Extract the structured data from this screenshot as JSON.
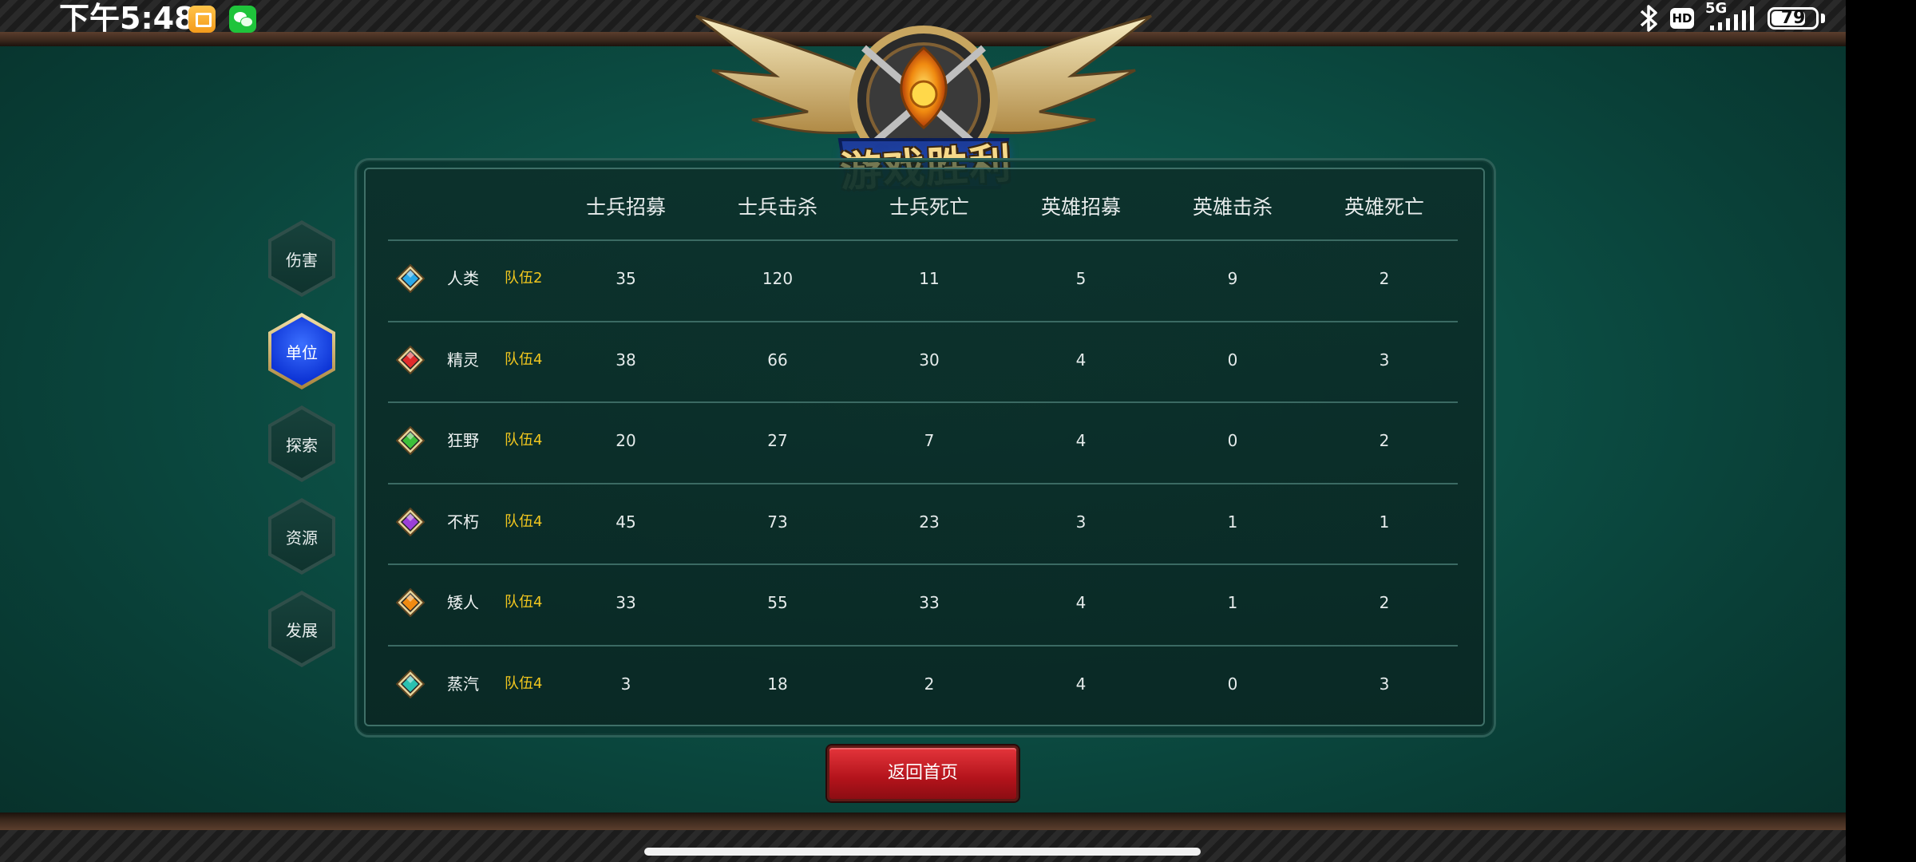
{
  "status_bar": {
    "time": "下午5:48",
    "hd": "HD",
    "network": "5G",
    "battery": "79",
    "battery_level": 0.79,
    "icons": [
      "notes-app-icon",
      "wechat-icon",
      "bluetooth-icon",
      "signal-icon",
      "battery-icon"
    ]
  },
  "emblem": {
    "title": "游戏胜利"
  },
  "nav": {
    "items": [
      {
        "label": "伤害",
        "active": false
      },
      {
        "label": "单位",
        "active": true
      },
      {
        "label": "探索",
        "active": false
      },
      {
        "label": "资源",
        "active": false
      },
      {
        "label": "发展",
        "active": false
      }
    ]
  },
  "table": {
    "headers": [
      "士兵招募",
      "士兵击杀",
      "士兵死亡",
      "英雄招募",
      "英雄击杀",
      "英雄死亡"
    ],
    "rows": [
      {
        "race": "人类",
        "team": "队伍2",
        "gem_color": "#2aa8e8",
        "values": [
          "35",
          "120",
          "11",
          "5",
          "9",
          "2"
        ]
      },
      {
        "race": "精灵",
        "team": "队伍4",
        "gem_color": "#e02b2b",
        "values": [
          "38",
          "66",
          "30",
          "4",
          "0",
          "3"
        ]
      },
      {
        "race": "狂野",
        "team": "队伍4",
        "gem_color": "#3cbf3a",
        "values": [
          "20",
          "27",
          "7",
          "4",
          "0",
          "2"
        ]
      },
      {
        "race": "不朽",
        "team": "队伍4",
        "gem_color": "#9b3fd8",
        "values": [
          "45",
          "73",
          "23",
          "3",
          "1",
          "1"
        ]
      },
      {
        "race": "矮人",
        "team": "队伍4",
        "gem_color": "#f08a12",
        "values": [
          "33",
          "55",
          "33",
          "4",
          "1",
          "2"
        ]
      },
      {
        "race": "蒸汽",
        "team": "队伍4",
        "gem_color": "#2bc0b0",
        "values": [
          "3",
          "18",
          "2",
          "4",
          "0",
          "3"
        ]
      }
    ]
  },
  "footer": {
    "return_button": "返回首页"
  },
  "colors": {
    "team_text": "#f2c71e",
    "button_red": "#c4161f",
    "active_nav": "#1a4bff"
  }
}
